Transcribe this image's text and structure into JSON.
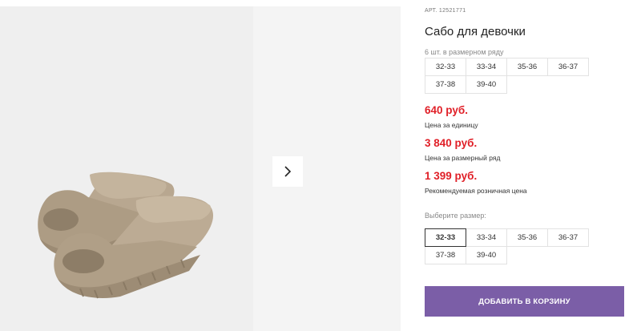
{
  "product": {
    "article": "АРТ. 12521771",
    "title": "Сабо для девочки",
    "pack_note": "6 шт. в размерном ряду",
    "pack_sizes": [
      "32-33",
      "33-34",
      "35-36",
      "36-37",
      "37-38",
      "39-40"
    ],
    "price_unit": "640 руб.",
    "price_unit_label": "Цена за единицу",
    "price_pack": "3 840 руб.",
    "price_pack_label": "Цена за размерный ряд",
    "price_retail": "1 399 руб.",
    "price_retail_label": "Рекомендуемая розничная цена",
    "choose_size_label": "Выберите размер:",
    "sizes": [
      "32-33",
      "33-34",
      "35-36",
      "36-37",
      "37-38",
      "39-40"
    ],
    "selected_size": "32-33",
    "add_to_cart_label": "ДОБАВИТЬ В КОРЗИНУ"
  },
  "gallery": {
    "next_icon": "chevron-right-icon"
  },
  "colors": {
    "price": "#e02028",
    "button": "#7b5ea7",
    "sandal": "#b6a58e"
  }
}
